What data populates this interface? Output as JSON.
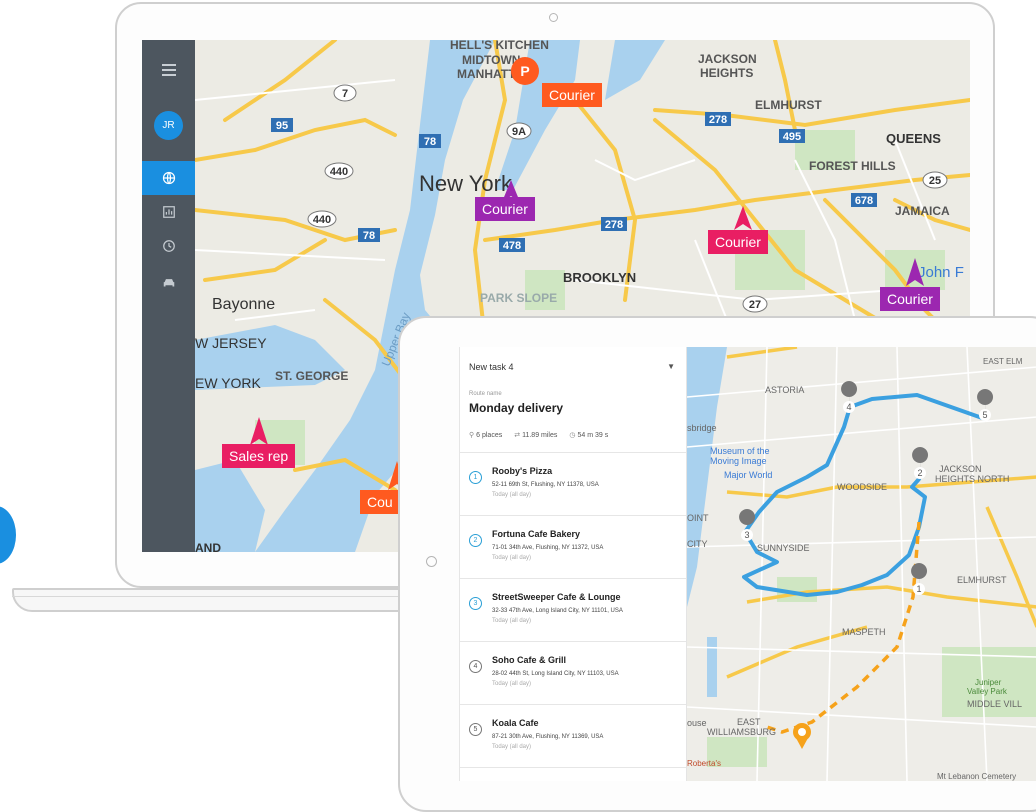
{
  "laptop": {
    "sidebar": {
      "avatar_initials": "JR",
      "menu_icon": "hamburger-menu-icon",
      "items": [
        {
          "icon": "globe-icon",
          "active": true
        },
        {
          "icon": "report-icon",
          "active": false
        },
        {
          "icon": "clock-icon",
          "active": false
        },
        {
          "icon": "car-icon",
          "active": false
        }
      ],
      "accent": "#1a8fe0",
      "background": "#4d565f"
    },
    "map": {
      "place_labels": [
        "HELL'S KITCHEN",
        "MIDTOWN MANHATTAN",
        "JACKSON HEIGHTS",
        "ELMHURST",
        "QUEENS",
        "FOREST HILLS",
        "JAMAICA",
        "New York",
        "BROOKLYN",
        "PARK SLOPE",
        "Bayonne",
        "W JERSEY",
        "EW YORK",
        "ST. GEORGE",
        "Upper Bay",
        "John F",
        "AND"
      ],
      "highway_shields": [
        "95",
        "7",
        "78",
        "9A",
        "278",
        "495",
        "440",
        "440",
        "78",
        "278",
        "478",
        "678",
        "25",
        "27"
      ],
      "markers": [
        {
          "label": "Courier",
          "color": "#ff5a1f",
          "badge": "P"
        },
        {
          "label": "Courier",
          "color": "#9c27b0"
        },
        {
          "label": "Courier",
          "color": "#e91e63"
        },
        {
          "label": "Courier",
          "color": "#9c27b0"
        },
        {
          "label": "Sales rep",
          "color": "#e91e63"
        },
        {
          "label": "Cou",
          "color": "#ff5a1f"
        }
      ]
    }
  },
  "tablet": {
    "task_select": "New task 4",
    "route_caption": "Route name",
    "route_name": "Monday delivery",
    "stats": {
      "places": "6 places",
      "distance": "11.89 miles",
      "duration": "54 m 39 s"
    },
    "stops": [
      {
        "num": "1",
        "name": "Rooby's Pizza",
        "address": "52-11 69th St, Flushing, NY 11378, USA",
        "time": "Today (all day)"
      },
      {
        "num": "2",
        "name": "Fortuna Cafe Bakery",
        "address": "71-01 34th Ave, Flushing, NY 11372, USA",
        "time": "Today (all day)"
      },
      {
        "num": "3",
        "name": "StreetSweeper Cafe & Lounge",
        "address": "32-33 47th Ave, Long Island City, NY 11101, USA",
        "time": "Today (all day)"
      },
      {
        "num": "4",
        "name": "Soho Cafe & Grill",
        "address": "28-02 44th St, Long Island City, NY 11103, USA",
        "time": "Today (all day)"
      },
      {
        "num": "5",
        "name": "Koala Cafe",
        "address": "87-21 30th Ave, Flushing, NY 11369, USA",
        "time": "Today (all day)"
      }
    ],
    "map": {
      "labels": [
        "EAST ELM",
        "ASTORIA",
        "Museum of the Moving Image",
        "Major World",
        "WOODSIDE",
        "JACKSON HEIGHTS",
        "NORTH",
        "SUNNYSIDE",
        "ELMHURST",
        "MASPETH",
        "Juniper Valley Park",
        "MIDDLE VILL",
        "EAST WILLIAMSBURG",
        "Roberta's",
        "Mt Lebanon Cemetery",
        "sbridge",
        "OINT",
        "CITY",
        "ouse"
      ],
      "route_color": "#3ba0e0",
      "pending_color": "#f6a21a"
    }
  }
}
